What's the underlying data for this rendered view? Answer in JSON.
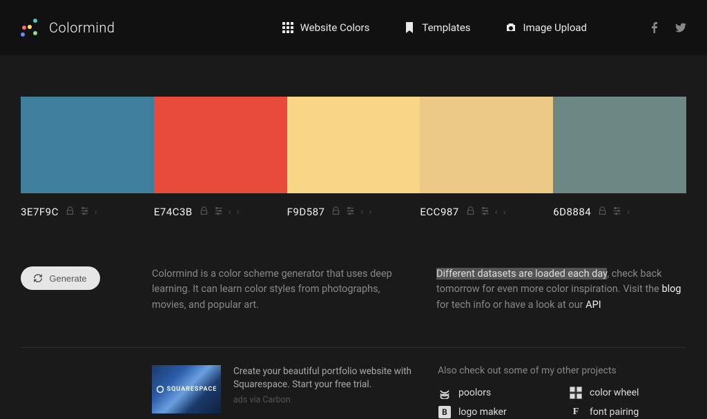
{
  "brand": "Colormind",
  "nav": {
    "website_colors": "Website Colors",
    "templates": "Templates",
    "image_upload": "Image Upload"
  },
  "palette": [
    {
      "hex": "3E7F9C",
      "color": "#3E7F9C",
      "hasPrev": false,
      "hasNext": true
    },
    {
      "hex": "E74C3B",
      "color": "#E74C3B",
      "hasPrev": true,
      "hasNext": true
    },
    {
      "hex": "F9D587",
      "color": "#F9D587",
      "hasPrev": true,
      "hasNext": true
    },
    {
      "hex": "ECC987",
      "color": "#ECC987",
      "hasPrev": true,
      "hasNext": true
    },
    {
      "hex": "6D8884",
      "color": "#6D8884",
      "hasPrev": true,
      "hasNext": false
    }
  ],
  "generate_label": "Generate",
  "description1": "Colormind is a color scheme generator that uses deep learning. It can learn color styles from photographs, movies, and popular art.",
  "description2": {
    "highlight": "Different datasets are loaded each day",
    "text1": ", check back tomorrow for even more color inspiration. Visit the ",
    "link1": "blog",
    "text2": " for tech info or have a look at our ",
    "link2": "API"
  },
  "ad": {
    "brand": "SQUARESPACE",
    "text": "Create your beautiful portfolio website with Squarespace. Start your free trial.",
    "sub": "ads via Carbon"
  },
  "projects": {
    "title": "Also check out some of my other projects",
    "items": [
      {
        "name": "poolors"
      },
      {
        "name": "color wheel"
      },
      {
        "name": "logo maker"
      },
      {
        "name": "font pairing"
      }
    ]
  }
}
